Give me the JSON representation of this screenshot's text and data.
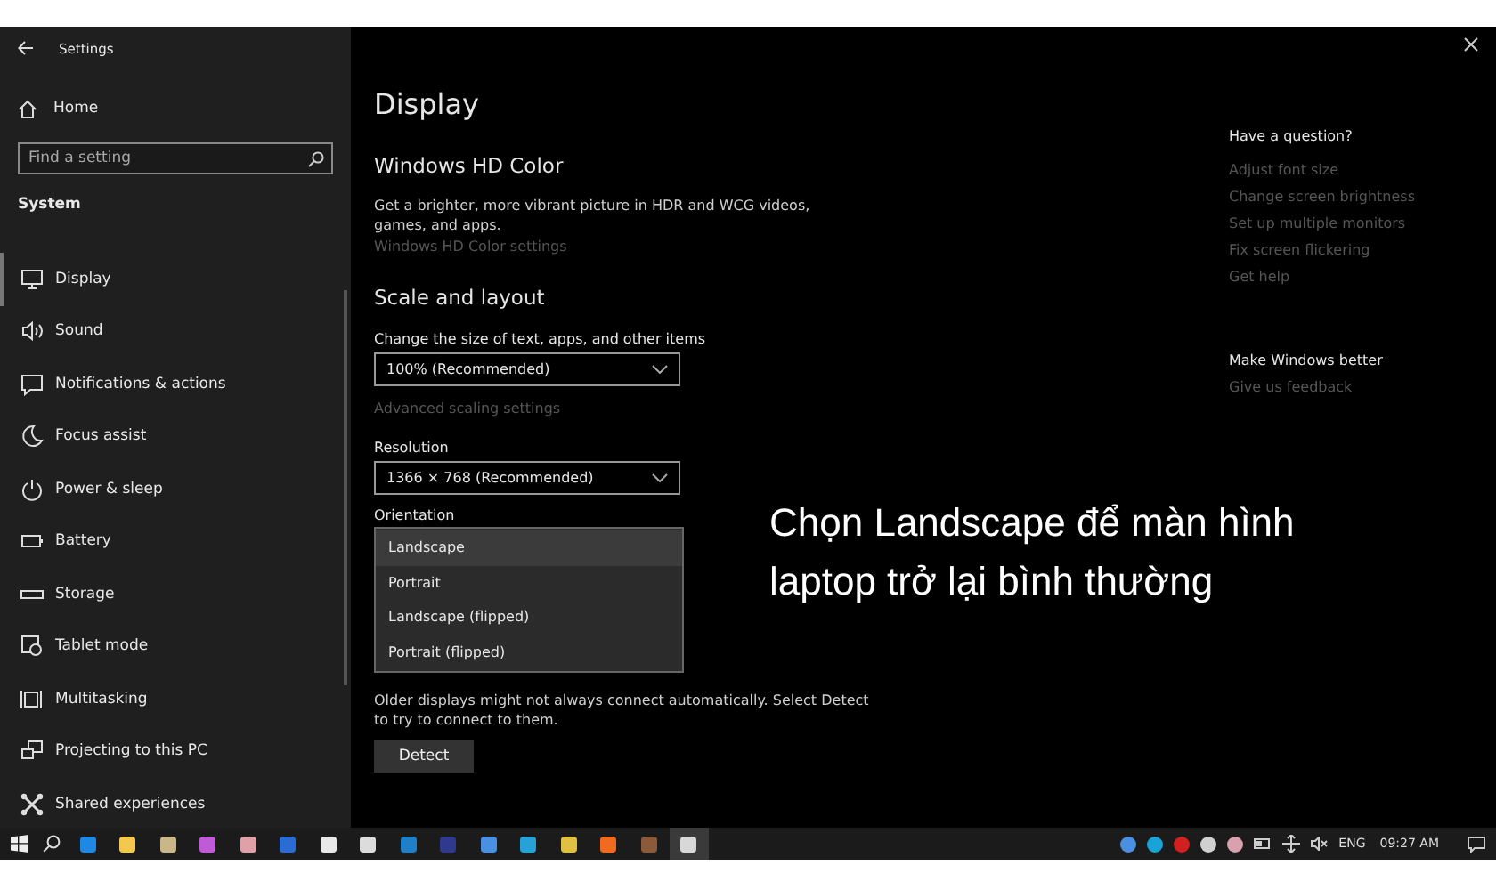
{
  "window": {
    "title": "Settings"
  },
  "sidebar": {
    "home": "Home",
    "search": {
      "placeholder": "Find a setting"
    },
    "section": "System",
    "items": [
      {
        "label": "Display",
        "selected": true
      },
      {
        "label": "Sound",
        "selected": false
      },
      {
        "label": "Notifications & actions",
        "selected": false
      },
      {
        "label": "Focus assist",
        "selected": false
      },
      {
        "label": "Power & sleep",
        "selected": false
      },
      {
        "label": "Battery",
        "selected": false
      },
      {
        "label": "Storage",
        "selected": false
      },
      {
        "label": "Tablet mode",
        "selected": false
      },
      {
        "label": "Multitasking",
        "selected": false
      },
      {
        "label": "Projecting to this PC",
        "selected": false
      },
      {
        "label": "Shared experiences",
        "selected": false
      }
    ]
  },
  "main": {
    "title": "Display",
    "hd_color": {
      "heading": "Windows HD Color",
      "description": "Get a brighter, more vibrant picture in HDR and WCG videos, games, and apps.",
      "link": "Windows HD Color settings"
    },
    "scale": {
      "heading": "Scale and layout",
      "size_label": "Change the size of text, apps, and other items",
      "size_value": "100% (Recommended)",
      "advanced_link": "Advanced scaling settings",
      "resolution_label": "Resolution",
      "resolution_value": "1366 × 768 (Recommended)",
      "orientation_label": "Orientation",
      "orientation_options": [
        {
          "label": "Landscape",
          "selected": true
        },
        {
          "label": "Portrait",
          "selected": false
        },
        {
          "label": "Landscape (flipped)",
          "selected": false
        },
        {
          "label": "Portrait (flipped)",
          "selected": false
        }
      ]
    },
    "detect_note": "Older displays might not always connect automatically. Select Detect to try to connect to them.",
    "detect_button": "Detect"
  },
  "help": {
    "heading": "Have a question?",
    "links": [
      "Adjust font size",
      "Change screen brightness",
      "Set up multiple monitors",
      "Fix screen flickering",
      "Get help"
    ],
    "feedback_heading": "Make Windows better",
    "feedback_link": "Give us feedback"
  },
  "caption": "Chọn Landscape để màn hình laptop trở lại bình thường",
  "taskbar": {
    "apps": [
      {
        "color": "#1e88e5",
        "selected": false
      },
      {
        "color": "#f2c94c",
        "selected": false
      },
      {
        "color": "#c9b78a",
        "selected": false
      },
      {
        "color": "#c05ad6",
        "selected": false
      },
      {
        "color": "#e0a0a8",
        "selected": false
      },
      {
        "color": "#2b6cd4",
        "selected": false
      },
      {
        "color": "#e8e8e8",
        "selected": false
      },
      {
        "color": "#dcdcdc",
        "selected": false
      },
      {
        "color": "#1f7fc8",
        "selected": false
      },
      {
        "color": "#2f3a8f",
        "selected": false
      },
      {
        "color": "#4a90e2",
        "selected": false
      },
      {
        "color": "#27a2d9",
        "selected": false
      },
      {
        "color": "#e0c040",
        "selected": false
      },
      {
        "color": "#f06a20",
        "selected": false
      },
      {
        "color": "#8a5a3a",
        "selected": false
      },
      {
        "color": "#d8d8d8",
        "selected": true
      }
    ],
    "tray": [
      {
        "color": "#4a8fe0"
      },
      {
        "color": "#1aa3d8"
      },
      {
        "color": "#d02020"
      },
      {
        "color": "#d0d0d0"
      },
      {
        "color": "#d9a0b0"
      }
    ],
    "language": "ENG",
    "time": "09:27 AM"
  }
}
